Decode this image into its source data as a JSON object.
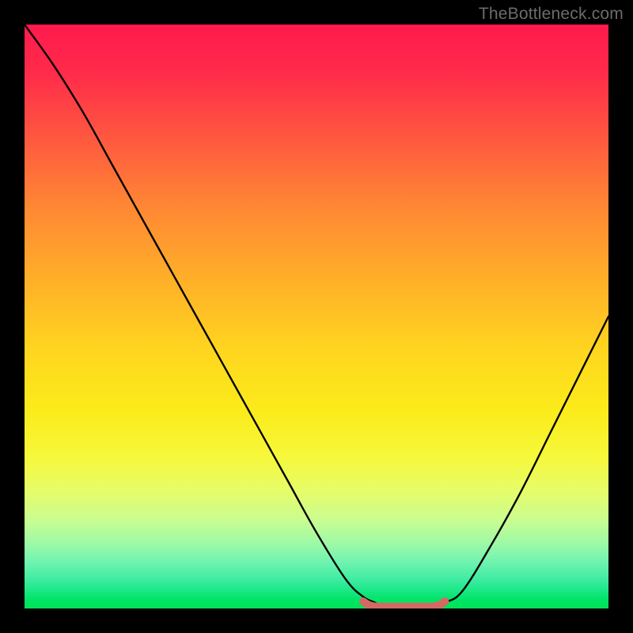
{
  "watermark": "TheBottleneck.com",
  "chart_data": {
    "type": "line",
    "title": "",
    "xlabel": "",
    "ylabel": "",
    "xlim": [
      0,
      100
    ],
    "ylim": [
      0,
      100
    ],
    "grid": false,
    "legend": false,
    "background_gradient": {
      "direction": "vertical",
      "stops": [
        {
          "pos": 0.0,
          "color": "#ff1a4d"
        },
        {
          "pos": 0.5,
          "color": "#ffd61f"
        },
        {
          "pos": 0.8,
          "color": "#e6fc6a"
        },
        {
          "pos": 1.0,
          "color": "#00e257"
        }
      ]
    },
    "series": [
      {
        "name": "bottleneck-curve",
        "color": "#000000",
        "x": [
          0,
          5,
          10,
          15,
          20,
          25,
          30,
          35,
          40,
          45,
          50,
          55,
          58,
          60,
          62,
          66,
          70,
          72,
          75,
          80,
          85,
          90,
          95,
          100
        ],
        "values": [
          100,
          93,
          85,
          76,
          67,
          58,
          49,
          40,
          31,
          22,
          13,
          5,
          2,
          1,
          0,
          0,
          0,
          1,
          3,
          11,
          20,
          30,
          40,
          50
        ]
      }
    ],
    "marker": {
      "name": "optimal-zone",
      "color": "#d26a63",
      "x_start": 58,
      "x_end": 72,
      "y": 1.2
    }
  }
}
